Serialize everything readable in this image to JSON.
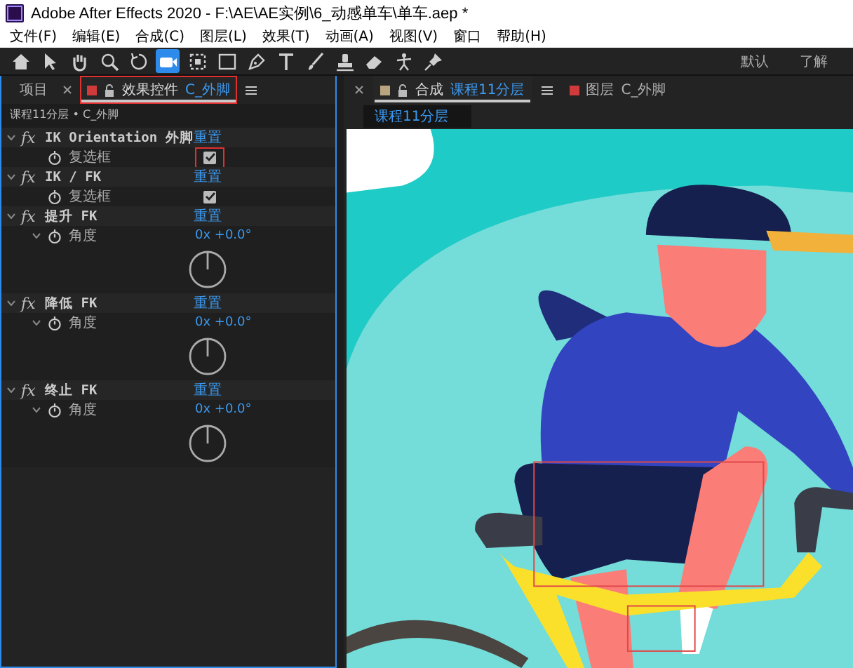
{
  "window": {
    "title": "Adobe After Effects 2020 - F:\\AE\\AE实例\\6_动感单车\\单车.aep *"
  },
  "menu": [
    "文件(F)",
    "编辑(E)",
    "合成(C)",
    "图层(L)",
    "效果(T)",
    "动画(A)",
    "视图(V)",
    "窗口",
    "帮助(H)"
  ],
  "toolbar": {
    "tools": [
      {
        "kind": "home",
        "selected": false
      },
      {
        "kind": "arrow",
        "selected": false
      },
      {
        "kind": "hand",
        "selected": false
      },
      {
        "kind": "zoom",
        "selected": false
      },
      {
        "kind": "rotate",
        "selected": false
      },
      {
        "kind": "camera",
        "selected": true
      },
      {
        "kind": "marquee",
        "selected": false
      },
      {
        "kind": "rect",
        "selected": false
      },
      {
        "kind": "pen",
        "selected": false
      },
      {
        "kind": "text",
        "selected": false
      },
      {
        "kind": "brush",
        "selected": false
      },
      {
        "kind": "stamp",
        "selected": false
      },
      {
        "kind": "eraser",
        "selected": false
      },
      {
        "kind": "puppet",
        "selected": false
      },
      {
        "kind": "pin",
        "selected": false
      }
    ],
    "workspaces": [
      "默认",
      "了解"
    ]
  },
  "left_panel": {
    "tabs": [
      {
        "label": "项目",
        "selected": false,
        "highlighted": false
      },
      {
        "label": "效果控件",
        "layer": "C_外脚",
        "color": "#d03a3a",
        "selected": true,
        "highlighted": true
      }
    ],
    "breadcrumb": "课程11分层 • C_外脚",
    "effects": [
      {
        "icon": "fx",
        "name": "IK Orientation 外脚",
        "reset": "重置",
        "params": [
          {
            "kind": "checkbox",
            "label": "复选框",
            "checked": true,
            "highlighted": true
          }
        ]
      },
      {
        "icon": "fx",
        "name": "IK / FK",
        "reset": "重置",
        "params": [
          {
            "kind": "checkbox",
            "label": "复选框",
            "checked": true,
            "highlighted": false
          }
        ]
      },
      {
        "icon": "fx",
        "name": "提升 FK",
        "reset": "重置",
        "params": [
          {
            "kind": "angle",
            "label": "角度",
            "value": "0x +0.0°"
          }
        ]
      },
      {
        "icon": "fx",
        "name": "降低 FK",
        "reset": "重置",
        "params": [
          {
            "kind": "angle",
            "label": "角度",
            "value": "0x +0.0°"
          }
        ]
      },
      {
        "icon": "fx",
        "name": "终止 FK",
        "reset": "重置",
        "params": [
          {
            "kind": "angle",
            "label": "角度",
            "value": "0x +0.0°"
          }
        ]
      }
    ]
  },
  "right_panel": {
    "tabs": [
      {
        "label": "合成",
        "name": "课程11分层",
        "color": "#b8a47e",
        "selected": true
      },
      {
        "label": "图层",
        "name": "C_外脚",
        "color": "#d03a3a",
        "selected": false
      }
    ],
    "comp_chip": "课程11分层"
  }
}
